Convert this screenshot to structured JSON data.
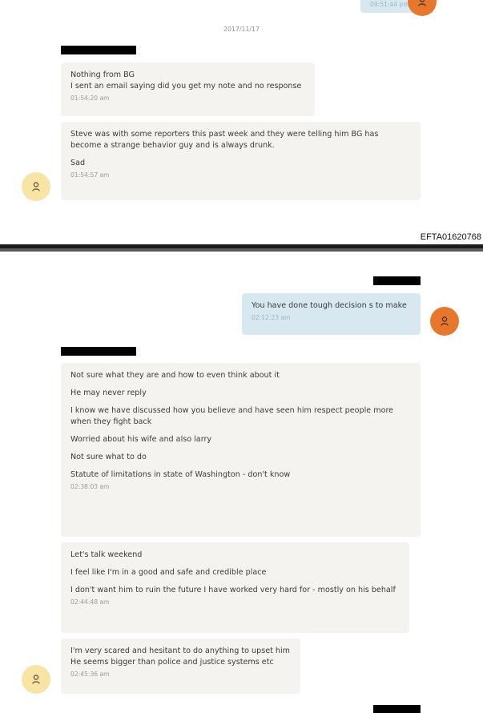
{
  "top_fragment": {
    "time": "09:51:44 pm"
  },
  "date_separator": "2017/11/17",
  "group1": {
    "msg1": {
      "lines": [
        "Nothing from BG",
        "I sent an email saying did you get my note and no response"
      ],
      "time": "01:54:20 am"
    },
    "msg2": {
      "para1": "Steve was with some reporters this past week and they were telling him BG has become a strange behavior guy and is always drunk.",
      "para2": "Sad",
      "time": "01:54:57 am"
    }
  },
  "page_label": "EFTA01620768",
  "outgoing": {
    "text": "You have done tough decision s to make",
    "time": "02:12:23 am"
  },
  "group2": {
    "msg1": {
      "paras": [
        "Not sure what they are and how to even think about it",
        "He may never reply",
        "I know we have discussed how you believe and have seen him respect people more when they fight back",
        "Worried about his wife and also larry",
        "Not sure what to do",
        "Statute of limitations in state of Washington - don't know"
      ],
      "time": "02:38:03 am"
    },
    "msg2": {
      "paras": [
        "Let's talk weekend",
        "I feel like I'm in a good and safe and credible place",
        "I don't want him to ruin the future I have worked very hard for - mostly on his behalf"
      ],
      "time": "02:44:48 am"
    },
    "msg3": {
      "lines": [
        "I'm very scared and hesitant to do anything to upset him",
        "He seems bigger than police and justice systems etc"
      ],
      "time": "02:45:36 am"
    }
  },
  "colors": {
    "incoming_bubble": "#f4f3f0",
    "outgoing_bubble": "#d7e8f1",
    "avatar_outgoing": "#e8772e",
    "avatar_incoming": "#f8e4a4",
    "redaction": "#000000"
  },
  "icons": {
    "avatar": "person-icon"
  }
}
